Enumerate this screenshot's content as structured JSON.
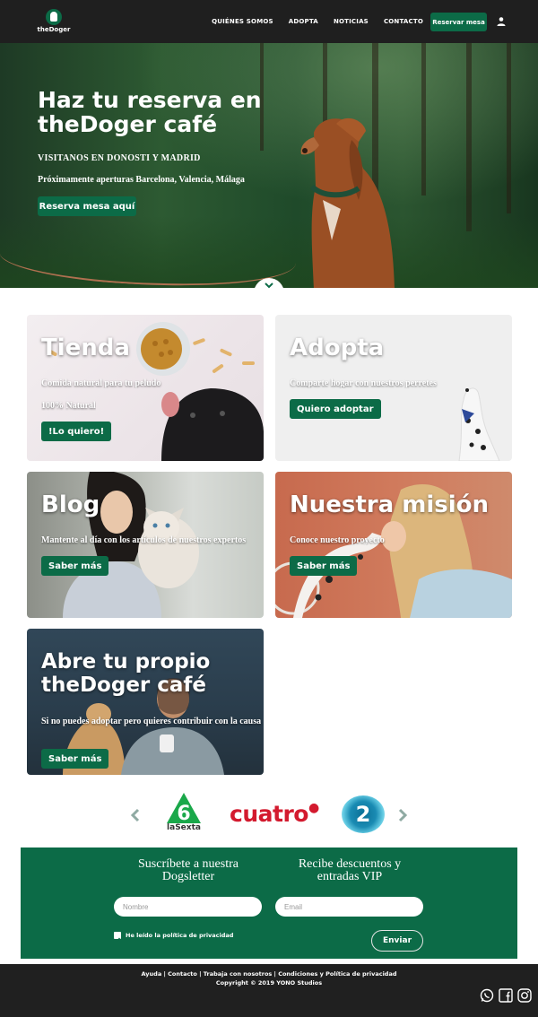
{
  "nav": {
    "logo_text": "theDoger",
    "links": [
      "QUIÉNES SOMOS",
      "ADOPTA",
      "NOTICIAS",
      "CONTACTO"
    ],
    "reserve_label": "Reservar mesa",
    "user_icon": "user-icon"
  },
  "hero": {
    "title": "Haz tu reserva en theDoger café",
    "subtitle": "VISITANOS EN DONOSTI Y MADRID",
    "upcoming": "Próximamente aperturas Barcelona, Valencia, Málaga",
    "button": "Reserva mesa aquí"
  },
  "cards": {
    "tienda": {
      "title": "Tienda",
      "line1": "Comida natural para tu peludo",
      "line2": "100% Natural",
      "button": "!Lo quiero!"
    },
    "adopta": {
      "title": "Adopta",
      "line1": "Comparte hogar con nuestros perretes",
      "button": "Quiero adoptar"
    },
    "blog": {
      "title": "Blog",
      "line1": "Mantente al día con los artículos de nuestros expertos",
      "button": "Saber más"
    },
    "mision": {
      "title": "Nuestra misión",
      "line1": "Conoce nuestro proyecto",
      "button": "Saber más"
    },
    "abre": {
      "title": "Abre tu propio theDoger café",
      "line1": "Si no puedes adoptar pero quieres contribuir con la causa",
      "button": "Saber más"
    }
  },
  "media_logos": {
    "lasexta_number": "6",
    "lasexta_caption": "laSexta",
    "cuatro": "cuatro",
    "dos": "2"
  },
  "newsletter": {
    "heading1": "Suscríbete a nuestra Dogsletter",
    "heading2": "Recibe descuentos y entradas VIP",
    "name_placeholder": "Nombre",
    "email_placeholder": "Email",
    "privacy_label": "He leído la política de privacidad",
    "privacy_checked": true,
    "send_label": "Enviar"
  },
  "footer": {
    "links": "Ayuda | Contacto | Trabaja con nosotros | Condiciones y Política de privacidad",
    "copyright": "Copyright © 2019 YONO Studios",
    "social_icons": [
      "whatsapp-icon",
      "facebook-icon",
      "instagram-icon"
    ]
  },
  "colors": {
    "brand_green": "#0c6b47",
    "nav_bg": "#1f1f1f",
    "footer_bg": "#202020"
  }
}
